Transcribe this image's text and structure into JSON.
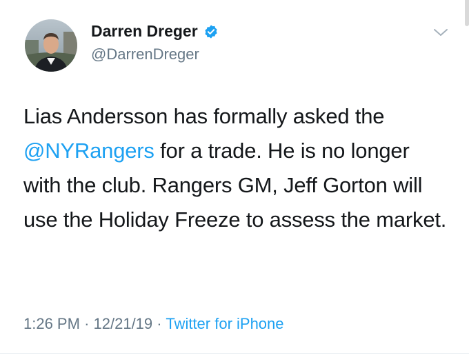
{
  "author": {
    "display_name": "Darren Dreger",
    "handle": "@DarrenDreger",
    "verified": true
  },
  "tweet": {
    "text_before_mention": "Lias Andersson has formally asked the ",
    "mention": "@NYRangers",
    "text_after_mention": " for a trade.  He is no longer with the club. Rangers GM, Jeff Gorton will use the Holiday Freeze to assess the market."
  },
  "meta": {
    "time": "1:26 PM",
    "separator": "·",
    "date": "12/21/19",
    "source": "Twitter for iPhone"
  },
  "icons": {
    "verified": "verified-badge-icon",
    "menu": "chevron-down-icon"
  },
  "colors": {
    "link": "#1da1f2",
    "primary_text": "#14171a",
    "secondary_text": "#657786"
  }
}
